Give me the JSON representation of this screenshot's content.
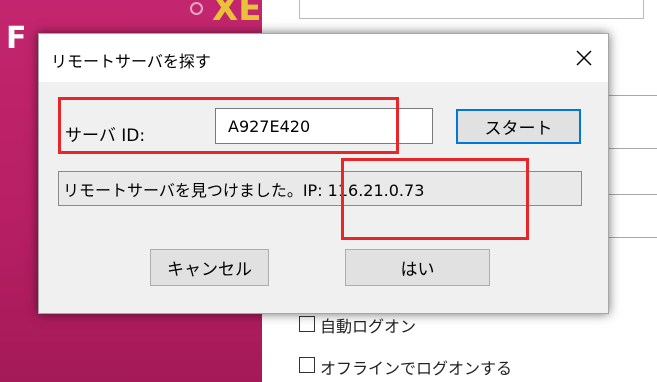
{
  "background_app": {
    "logo_letter": "F",
    "logo_suffix": "XE",
    "checkbox_auto_logon_label": "自動ログオン",
    "checkbox_offline_label": "オフラインでログオンする"
  },
  "dialog": {
    "title": "リモートサーバを探す",
    "close_symbol": "✕",
    "server_id_label": "サーバ ID:",
    "server_id_value": "A927E420",
    "start_button_label": "スタート",
    "status_text": "リモートサーバを見つけました。IP: 116.21.0.73",
    "cancel_button_label": "キャンセル",
    "ok_button_label": "はい"
  },
  "colors": {
    "brand_magenta": "#c3266e",
    "logo_gold": "#e8c238",
    "focus_blue": "#0078d7",
    "annotation_red": "#e8262a",
    "dialog_bg": "#f0f0f0"
  },
  "icons": {
    "close": "close-icon",
    "checkbox": "checkbox-icon"
  }
}
